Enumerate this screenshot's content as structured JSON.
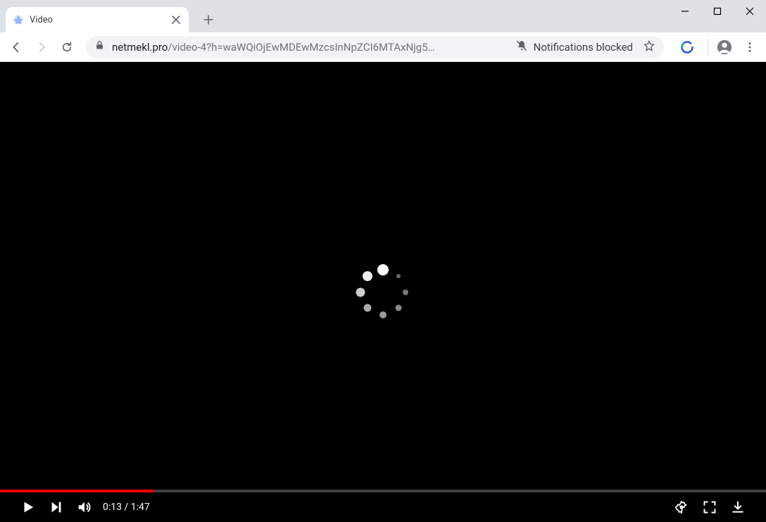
{
  "tab": {
    "title": "Video"
  },
  "address": {
    "host": "netmekl.pro",
    "path_display": "/video-4?h=waWQiOjEwMDEwMzcsInNpZCI6MTAxNjg5…",
    "notifications_blocked_label": "Notifications blocked"
  },
  "video": {
    "current_time": "0:13",
    "duration": "1:47",
    "time_display": "0:13 / 1:47",
    "progress_percent": 20
  }
}
